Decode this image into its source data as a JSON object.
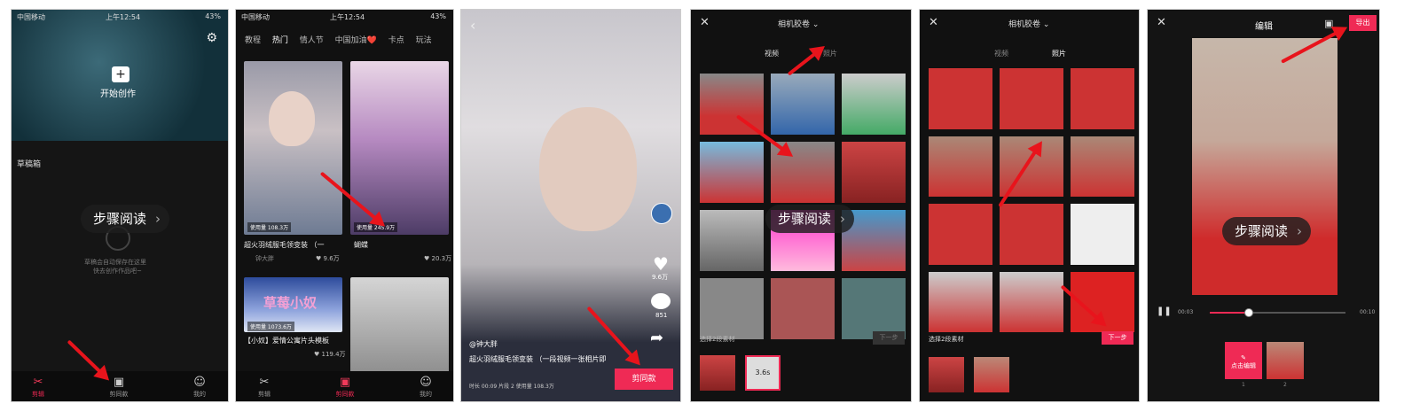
{
  "status_bar": {
    "carrier": "中国移动",
    "time": "上午12:54",
    "battery": "43%"
  },
  "screen1": {
    "start_create": "开始创作",
    "drafts_title": "草稿箱",
    "hint": "步骤阅读",
    "empty_line1": "草稿会自动保存在这里",
    "empty_line2": "快去创作作品吧~",
    "tabs": [
      "剪辑",
      "剪同款",
      "我的"
    ]
  },
  "screen2": {
    "categories": [
      "教程",
      "热门",
      "情人节",
      "中国加油❤️",
      "卡点",
      "玩法"
    ],
    "card1": {
      "usage": "使用量 108.3万",
      "title": "超火羽绒服毛领变装 （一",
      "author": "钟大胖",
      "likes": "9.6万"
    },
    "card2": {
      "usage": "使用量 245.9万",
      "title": "蝴蝶",
      "likes": "20.3万"
    },
    "card3": {
      "usage": "使用量 1073.6万",
      "title": "【小奴】爱情公寓片头模板",
      "banner": "草莓小奴",
      "likes": "119.4万"
    },
    "tabs": [
      "剪辑",
      "剪同款",
      "我的"
    ]
  },
  "screen3": {
    "author": "@钟大胖",
    "title": "超火羽绒服毛领变装 （一段视频一张相片即",
    "meta": "时长 00:09  片段 2  使用量 108.3万",
    "likes": "9.6万",
    "comments": "851",
    "use_button": "剪同款"
  },
  "screen4": {
    "title": "相机胶卷",
    "tabs": [
      "视频",
      "照片"
    ],
    "hint": "步骤阅读",
    "select_text": "选择2段素材",
    "next": "下一步",
    "slot_duration": "3.6s"
  },
  "screen5": {
    "title": "相机胶卷",
    "tabs": [
      "视频",
      "照片"
    ],
    "select_text": "选择2段素材",
    "next": "下一步"
  },
  "screen6": {
    "title": "编辑",
    "export": "导出",
    "hint": "步骤阅读",
    "time_start": "00:03",
    "time_end": "00:10",
    "clip1_label": "点击编辑",
    "clip_numbers": [
      "1",
      "2"
    ]
  },
  "colors": {
    "accent": "#ef2a55",
    "arrow": "#e8141c"
  }
}
